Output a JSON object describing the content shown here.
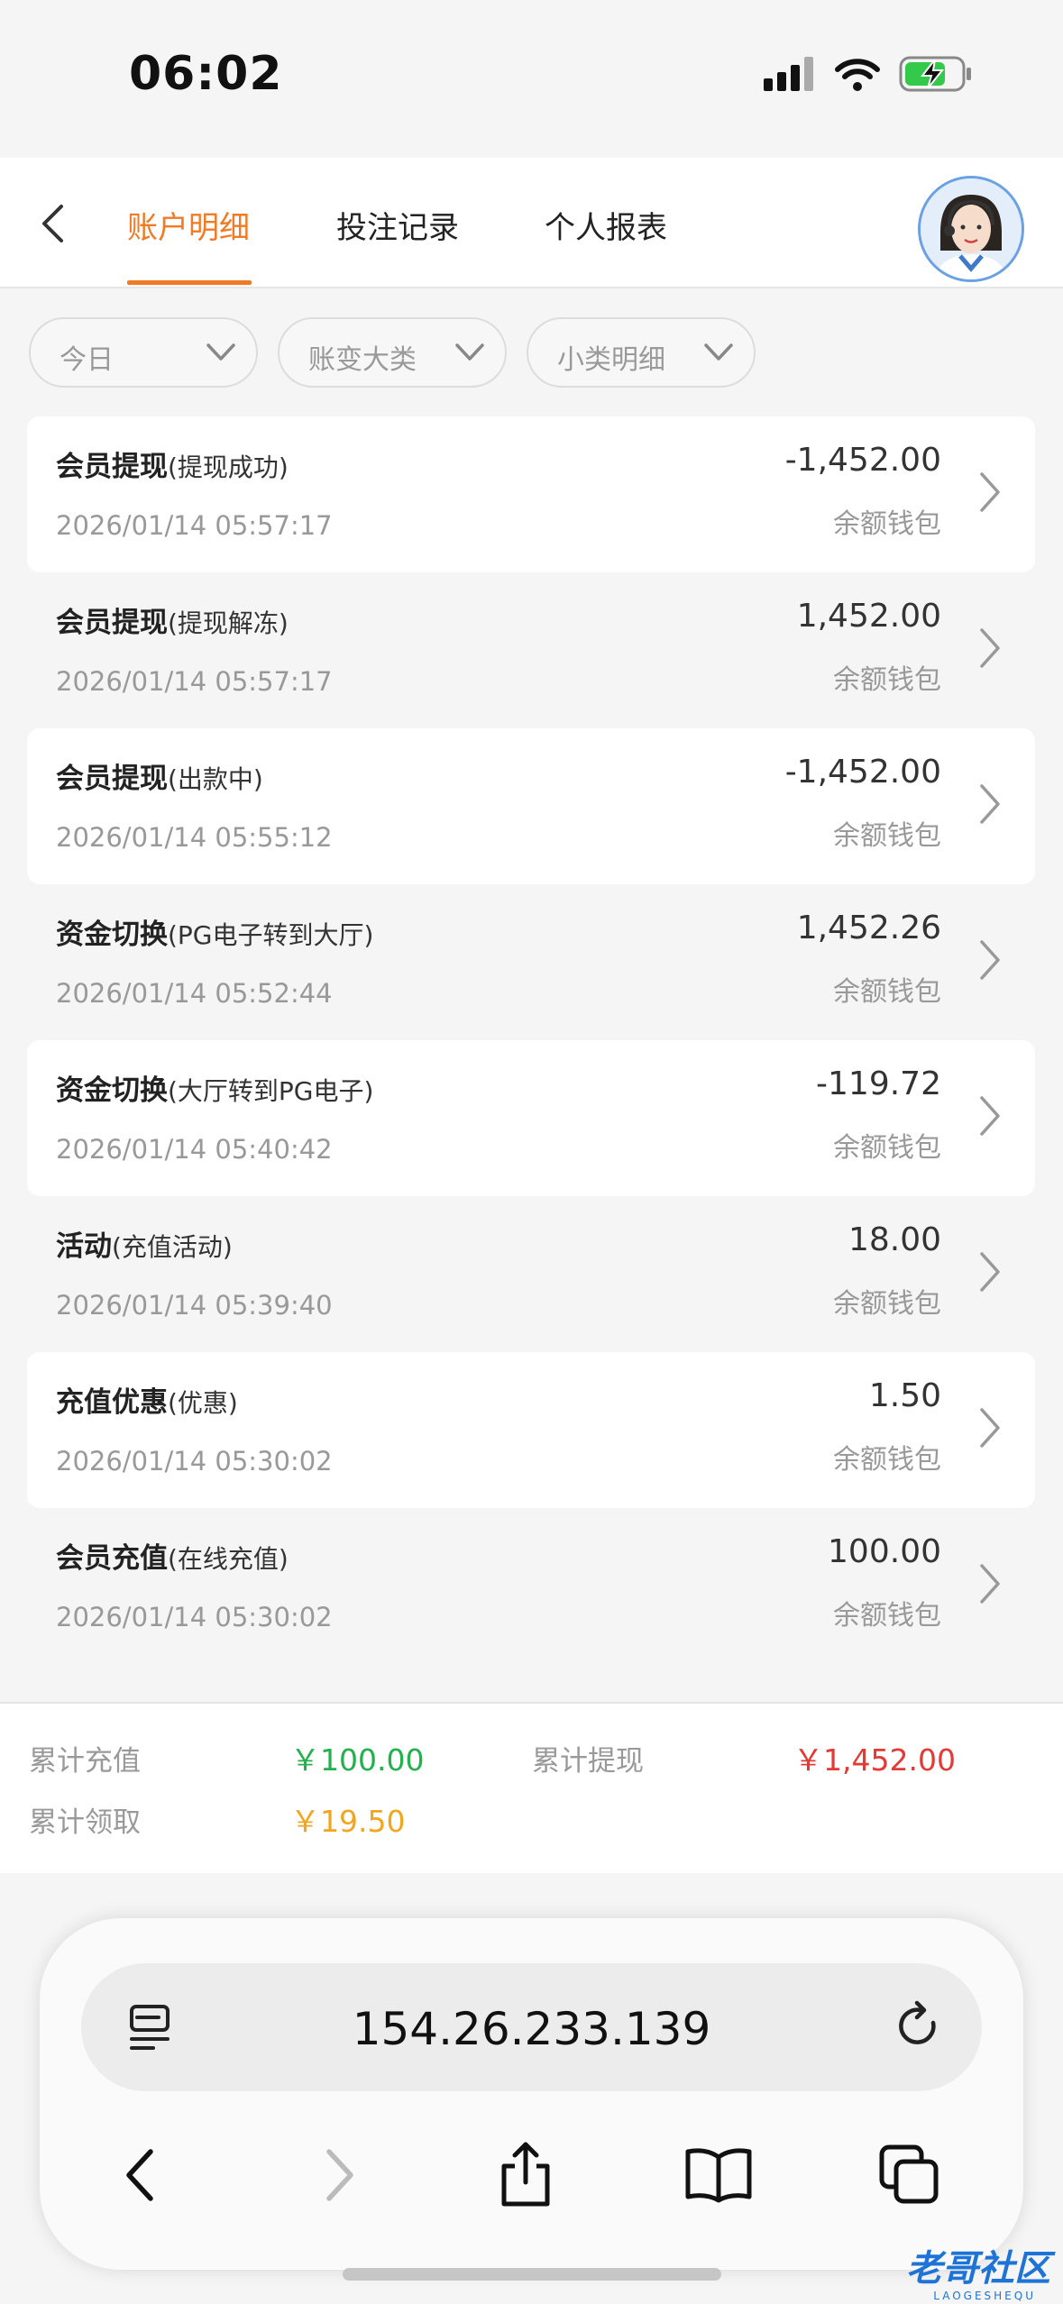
{
  "status": {
    "time": "06:02"
  },
  "header": {
    "tabs": [
      {
        "label": "账户明细",
        "active": true
      },
      {
        "label": "投注记录",
        "active": false
      },
      {
        "label": "个人报表",
        "active": false
      }
    ],
    "accent": "#f07a25"
  },
  "filters": [
    {
      "label": "今日"
    },
    {
      "label": "账变大类"
    },
    {
      "label": "小类明细"
    }
  ],
  "records": [
    {
      "title": "会员提现",
      "sub": "(提现成功)",
      "time": "2026/01/14 05:57:17",
      "amount": "-1,452.00",
      "wallet": "余额钱包"
    },
    {
      "title": "会员提现",
      "sub": "(提现解冻)",
      "time": "2026/01/14 05:57:17",
      "amount": "1,452.00",
      "wallet": "余额钱包"
    },
    {
      "title": "会员提现",
      "sub": "(出款中)",
      "time": "2026/01/14 05:55:12",
      "amount": "-1,452.00",
      "wallet": "余额钱包"
    },
    {
      "title": "资金切换",
      "sub": "(PG电子转到大厅)",
      "time": "2026/01/14 05:52:44",
      "amount": "1,452.26",
      "wallet": "余额钱包"
    },
    {
      "title": "资金切换",
      "sub": "(大厅转到PG电子)",
      "time": "2026/01/14 05:40:42",
      "amount": "-119.72",
      "wallet": "余额钱包"
    },
    {
      "title": "活动",
      "sub": "(充值活动)",
      "time": "2026/01/14 05:39:40",
      "amount": "18.00",
      "wallet": "余额钱包"
    },
    {
      "title": "充值优惠",
      "sub": "(优惠)",
      "time": "2026/01/14 05:30:02",
      "amount": "1.50",
      "wallet": "余额钱包"
    },
    {
      "title": "会员充值",
      "sub": "(在线充值)",
      "time": "2026/01/14 05:30:02",
      "amount": "100.00",
      "wallet": "余额钱包"
    }
  ],
  "summary": {
    "recharge_label": "累计充值",
    "recharge_value": "￥100.00",
    "withdraw_label": "累计提现",
    "withdraw_value": "￥1,452.00",
    "claim_label": "累计领取",
    "claim_value": "￥19.50",
    "colors": {
      "recharge": "#22b14c",
      "withdraw": "#e53935",
      "claim": "#f3a51c"
    }
  },
  "browser": {
    "url": "154.26.233.139"
  },
  "watermark": {
    "text": "老哥社区",
    "sub": "LAOGESHEQU"
  }
}
